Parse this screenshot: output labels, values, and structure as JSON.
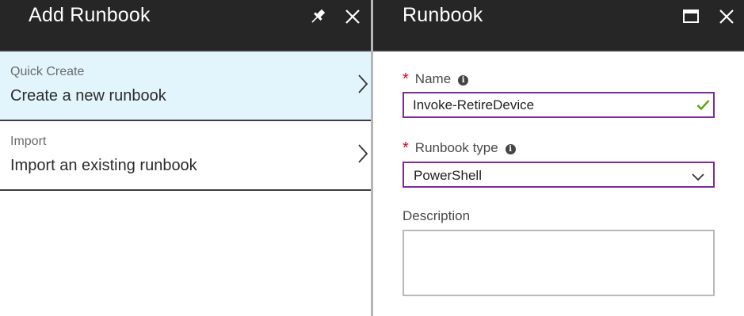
{
  "add_blade": {
    "title": "Add Runbook",
    "items": [
      {
        "subtitle": "Quick Create",
        "label": "Create a new runbook"
      },
      {
        "subtitle": "Import",
        "label": "Import an existing runbook"
      }
    ]
  },
  "runbook_blade": {
    "title": "Runbook",
    "name_field": {
      "label": "Name",
      "value": "Invoke-RetireDevice"
    },
    "type_field": {
      "label": "Runbook type",
      "value": "PowerShell"
    },
    "description_field": {
      "label": "Description",
      "value": ""
    }
  },
  "icons": {
    "pin": "pin-icon",
    "close": "close-icon",
    "maximize": "maximize-icon",
    "chevron": "chevron-right-icon",
    "dropdown": "chevron-down-icon",
    "valid": "checkmark-icon",
    "info": "info-icon"
  },
  "colors": {
    "header_bg": "#262626",
    "selected_bg": "#e2f5fc",
    "field_border": "#7f2a9a",
    "required": "#d0021b",
    "valid": "#57a300"
  }
}
